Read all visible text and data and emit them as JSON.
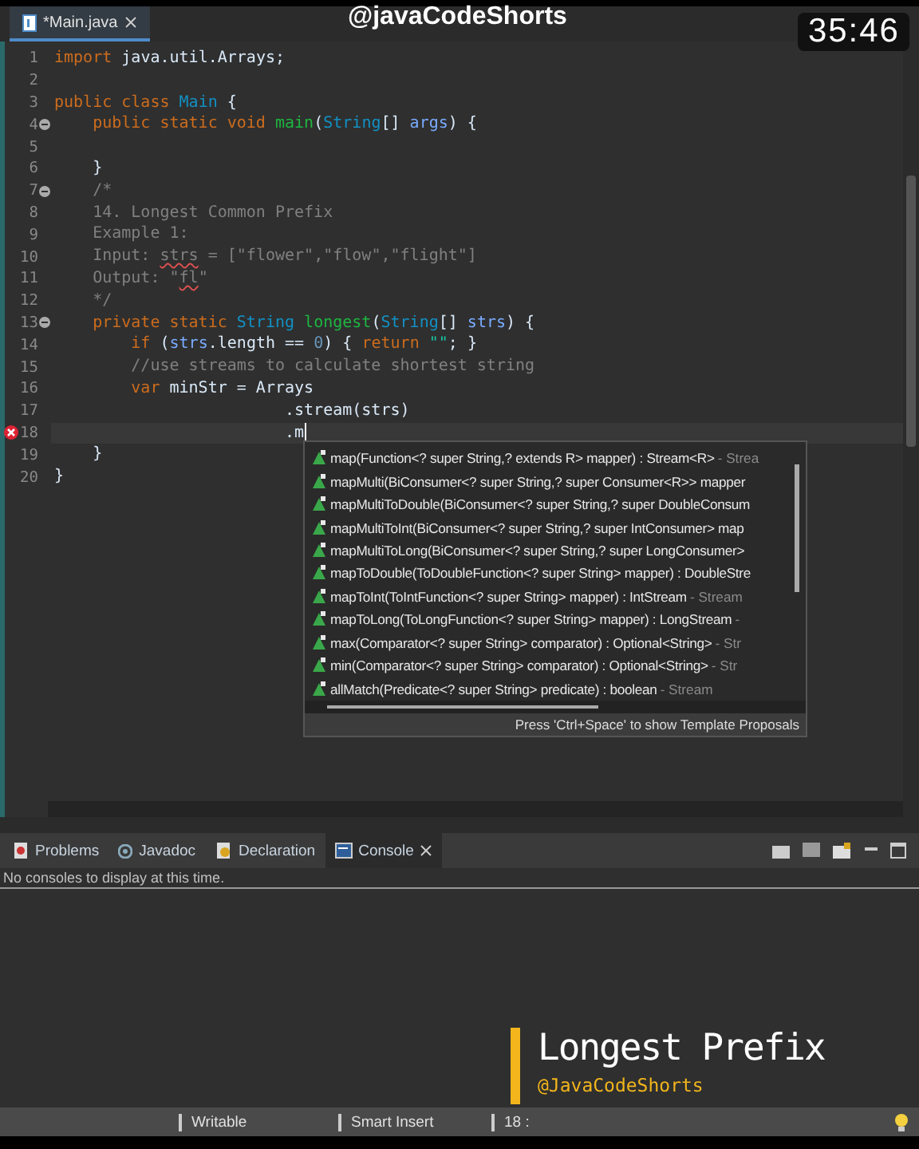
{
  "overlay": {
    "channel": "@javaCodeShorts",
    "timer": "35:46",
    "title": "Longest Prefix",
    "handle": "@JavaCodeShorts"
  },
  "editor_tabs": [
    {
      "label": "*Main.java",
      "selected": true
    }
  ],
  "code_lines": [
    {
      "number": "1",
      "current": false,
      "tokens": [
        {
          "kind": "keyword",
          "text": "import "
        },
        {
          "kind": "plain",
          "text": "java.util.Arrays;"
        }
      ]
    },
    {
      "number": "2"
    },
    {
      "number": "3",
      "current": false,
      "tokens": [
        {
          "kind": "keyword",
          "text": "public class "
        },
        {
          "kind": "type",
          "text": "Main "
        },
        {
          "kind": "plain",
          "text": "{"
        }
      ]
    },
    {
      "number": "4",
      "current": false,
      "kind": "fold",
      "tokens": [
        {
          "kind": "keyword",
          "text": "    public static void "
        },
        {
          "kind": "method",
          "text": "main"
        },
        {
          "kind": "plain",
          "text": "("
        },
        {
          "kind": "type",
          "text": "String"
        },
        {
          "kind": "plain",
          "text": "[] "
        },
        {
          "kind": "param",
          "text": "args"
        },
        {
          "kind": "plain",
          "text": ") {"
        }
      ]
    },
    {
      "number": "5"
    },
    {
      "number": "6",
      "current": false,
      "tokens": [
        {
          "kind": "plain",
          "text": "    }"
        }
      ]
    },
    {
      "number": "7",
      "current": false,
      "kind": "fold",
      "tokens": [
        {
          "kind": "comment",
          "text": "    /*"
        }
      ]
    },
    {
      "number": "8",
      "current": false,
      "tokens": [
        {
          "kind": "comment",
          "text": "    14. Longest Common Prefix"
        }
      ]
    },
    {
      "number": "9",
      "current": false,
      "tokens": [
        {
          "kind": "comment",
          "text": "    Example 1:"
        }
      ]
    },
    {
      "number": "10",
      "current": false,
      "tokens": [
        {
          "kind": "comment",
          "text": "    Input: "
        },
        {
          "kind": "misspelled",
          "text": "strs"
        },
        {
          "kind": "comment",
          "text": " = [\"flower\",\"flow\",\"flight\"]"
        }
      ]
    },
    {
      "number": "11",
      "current": false,
      "tokens": [
        {
          "kind": "comment",
          "text": "    Output: \""
        },
        {
          "kind": "misspelled",
          "text": "fl"
        },
        {
          "kind": "comment",
          "text": "\""
        }
      ]
    },
    {
      "number": "12",
      "current": false,
      "tokens": [
        {
          "kind": "comment",
          "text": "    */"
        }
      ]
    },
    {
      "number": "13",
      "current": false,
      "kind": "fold",
      "tokens": [
        {
          "kind": "keyword",
          "text": "    private static "
        },
        {
          "kind": "type",
          "text": "String "
        },
        {
          "kind": "method",
          "text": "longest"
        },
        {
          "kind": "plain",
          "text": "("
        },
        {
          "kind": "type",
          "text": "String"
        },
        {
          "kind": "plain",
          "text": "[] "
        },
        {
          "kind": "param",
          "text": "strs"
        },
        {
          "kind": "plain",
          "text": ") {"
        }
      ]
    },
    {
      "number": "14",
      "current": false,
      "tokens": [
        {
          "kind": "keyword",
          "text": "        if "
        },
        {
          "kind": "plain",
          "text": "("
        },
        {
          "kind": "param",
          "text": "strs"
        },
        {
          "kind": "plain",
          "text": ".length == "
        },
        {
          "kind": "number",
          "text": "0"
        },
        {
          "kind": "plain",
          "text": ") { "
        },
        {
          "kind": "keyword",
          "text": "return "
        },
        {
          "kind": "string",
          "text": "\"\""
        },
        {
          "kind": "plain",
          "text": "; }"
        }
      ]
    },
    {
      "number": "15",
      "current": false,
      "tokens": [
        {
          "kind": "comment",
          "text": "        //use streams to calculate shortest string"
        }
      ]
    },
    {
      "number": "16",
      "current": false,
      "tokens": [
        {
          "kind": "keyword",
          "text": "        var "
        },
        {
          "kind": "plain",
          "text": "minStr = Arrays"
        }
      ]
    },
    {
      "number": "17",
      "current": false,
      "tokens": [
        {
          "kind": "plain",
          "text": "                        .stream(strs)"
        }
      ]
    },
    {
      "number": "18",
      "current": true,
      "kind": "error",
      "tokens": [
        {
          "kind": "plain",
          "text": "                        .m"
        }
      ]
    },
    {
      "number": "19",
      "current": false,
      "tokens": [
        {
          "kind": "plain",
          "text": "    }"
        }
      ]
    },
    {
      "number": "20",
      "current": false,
      "tokens": [
        {
          "kind": "plain",
          "text": "}"
        }
      ]
    }
  ],
  "completion": {
    "items": [
      {
        "signature": "map(Function<? super String,? extends R> mapper) : Stream<R>",
        "qualifier": "- Strea",
        "selected": false
      },
      {
        "signature": "mapMulti(BiConsumer<? super String,? super Consumer<R>> mapper",
        "selected": false
      },
      {
        "signature": "mapMultiToDouble(BiConsumer<? super String,? super DoubleConsum",
        "selected": false
      },
      {
        "signature": "mapMultiToInt(BiConsumer<? super String,? super IntConsumer> map",
        "selected": false
      },
      {
        "signature": "mapMultiToLong(BiConsumer<? super String,? super LongConsumer>",
        "selected": false
      },
      {
        "signature": "mapToDouble(ToDoubleFunction<? super String> mapper) : DoubleStre",
        "selected": false
      },
      {
        "signature": "mapToInt(ToIntFunction<? super String> mapper) : IntStream",
        "qualifier": "- Stream",
        "selected": false
      },
      {
        "signature": "mapToLong(ToLongFunction<? super String> mapper) : LongStream",
        "qualifier": "-",
        "selected": false
      },
      {
        "signature": "max(Comparator<? super String> comparator) : Optional<String>",
        "qualifier": "- Str",
        "selected": false
      },
      {
        "signature": "min(Comparator<? super String> comparator) : Optional<String>",
        "qualifier": "- Str",
        "selected": false
      },
      {
        "signature": "allMatch(Predicate<? super String> predicate) : boolean",
        "qualifier": "- Stream",
        "selected": false
      }
    ],
    "footer": "Press 'Ctrl+Space' to show Template Proposals"
  },
  "panel_tabs": [
    {
      "label": "Problems",
      "kind": "problems",
      "selected": false
    },
    {
      "label": "Javadoc",
      "kind": "javadoc",
      "selected": false
    },
    {
      "label": "Declaration",
      "kind": "declaration",
      "selected": false
    },
    {
      "label": "Console",
      "kind": "console",
      "selected": true
    }
  ],
  "console_message": "No consoles to display at this time.",
  "status_bar": [
    "Writable",
    "Smart Insert",
    "18 :"
  ]
}
